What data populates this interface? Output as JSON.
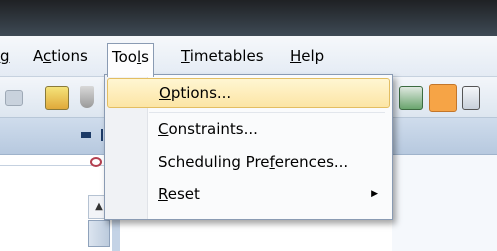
{
  "menubar": {
    "items": [
      {
        "pre": "",
        "ul": "g",
        "post": ""
      },
      {
        "pre": "A",
        "ul": "c",
        "post": "tions"
      },
      {
        "pre": "Too",
        "ul": "l",
        "post": "s"
      },
      {
        "pre": "",
        "ul": "T",
        "post": "imetables"
      },
      {
        "pre": "",
        "ul": "H",
        "post": "elp"
      }
    ]
  },
  "dropdown": {
    "items": [
      {
        "pre": "",
        "ul": "O",
        "post": "ptions...",
        "submenu": false
      },
      {
        "pre": "",
        "ul": "C",
        "post": "onstraints...",
        "submenu": false
      },
      {
        "pre": "Scheduling Pre",
        "ul": "f",
        "post": "erences...",
        "submenu": false
      },
      {
        "pre": "",
        "ul": "R",
        "post": "eset",
        "submenu": true
      }
    ],
    "submenu_arrow": "▶"
  },
  "scroll": {
    "up_arrow": "▲"
  },
  "colors": {
    "menu_highlight": "#fce5a5",
    "titlebar": "#1f2124"
  }
}
